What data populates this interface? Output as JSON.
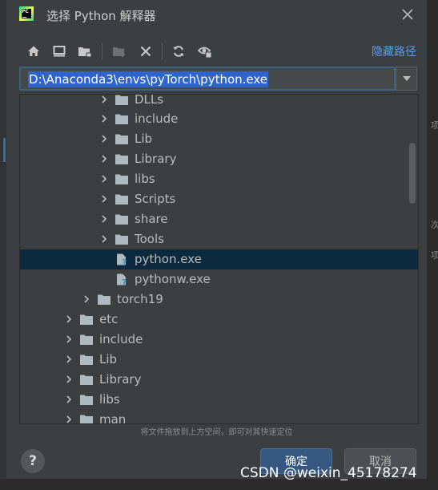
{
  "dialog": {
    "title": "选择 Python 解释器",
    "hide_path_label": "隐藏路径",
    "path_value": "D:\\Anaconda3\\envs\\pyTorch\\python.exe",
    "app_icon_text": "PC",
    "hint": "将文件拖放到上方空间，即可对其快速定位",
    "help_label": "?",
    "ok_label": "确定",
    "cancel_label": "取消"
  },
  "toolbar": {
    "icons": [
      "home-icon",
      "desktop-icon",
      "project-folder-icon",
      "new-folder-icon",
      "delete-icon",
      "refresh-icon",
      "show-hidden-icon"
    ]
  },
  "tree": {
    "items": [
      {
        "label": "DLLs",
        "type": "folder",
        "expandable": true
      },
      {
        "label": "include",
        "type": "folder",
        "expandable": true
      },
      {
        "label": "Lib",
        "type": "folder",
        "expandable": true
      },
      {
        "label": "Library",
        "type": "folder",
        "expandable": true
      },
      {
        "label": "libs",
        "type": "folder",
        "expandable": true
      },
      {
        "label": "Scripts",
        "type": "folder",
        "expandable": true
      },
      {
        "label": "share",
        "type": "folder",
        "expandable": true
      },
      {
        "label": "Tools",
        "type": "folder",
        "expandable": true
      },
      {
        "label": "python.exe",
        "type": "file",
        "expandable": false,
        "selected": true
      },
      {
        "label": "pythonw.exe",
        "type": "file",
        "expandable": false
      },
      {
        "label": "torch19",
        "type": "folder",
        "expandable": true
      },
      {
        "label": "etc",
        "type": "folder",
        "expandable": true
      },
      {
        "label": "include",
        "type": "folder",
        "expandable": true
      },
      {
        "label": "Lib",
        "type": "folder",
        "expandable": true
      },
      {
        "label": "Library",
        "type": "folder",
        "expandable": true
      },
      {
        "label": "libs",
        "type": "folder",
        "expandable": true
      },
      {
        "label": "man",
        "type": "folder",
        "expandable": true
      }
    ]
  },
  "background": {
    "right_glyphs": [
      "项",
      "次",
      "项"
    ]
  },
  "watermark": "CSDN @weixin_45178274",
  "colors": {
    "dialog_bg": "#3c3f41",
    "selection_bg": "#0d293e",
    "link": "#589df6",
    "ok_button": "#365880",
    "path_highlight": "#2f65ca"
  }
}
